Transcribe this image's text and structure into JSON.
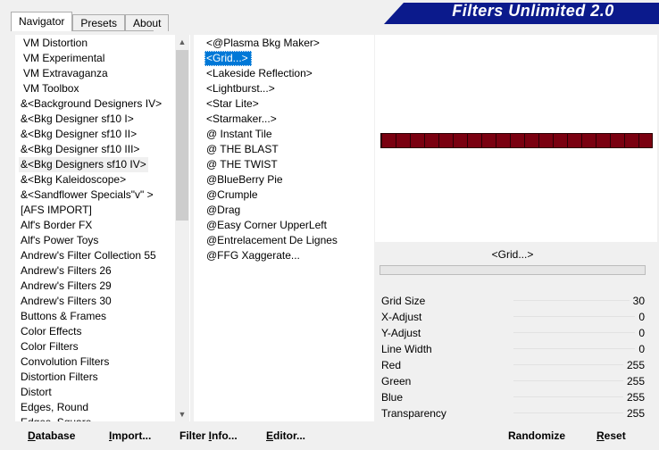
{
  "tabs": [
    {
      "label": "Navigator",
      "active": true
    },
    {
      "label": "Presets",
      "active": false
    },
    {
      "label": "About",
      "active": false
    }
  ],
  "banner": {
    "title": "Filters Unlimited 2.0",
    "color": "#0b1a8c"
  },
  "categories": [
    "VM Distortion",
    "VM Experimental",
    "VM Extravaganza",
    "VM Toolbox",
    "&<Background Designers IV>",
    "&<Bkg Designer sf10 I>",
    "&<Bkg Designer sf10 II>",
    "&<Bkg Designer sf10 III>",
    "&<Bkg Designers sf10 IV>",
    "&<Bkg Kaleidoscope>",
    "&<Sandflower Specials\"v\" >",
    "[AFS IMPORT]",
    "Alf's Border FX",
    "Alf's Power Toys",
    "Andrew's Filter Collection 55",
    "Andrew's Filters 26",
    "Andrew's Filters 29",
    "Andrew's Filters 30",
    "Buttons & Frames",
    "Color Effects",
    "Color Filters",
    "Convolution Filters",
    "Distortion Filters",
    "Distort",
    "Edges, Round",
    "Edges, Square"
  ],
  "category_highlighted_index": 8,
  "filters": [
    "<@Plasma Bkg Maker>",
    "<Grid...>",
    "<Lakeside Reflection>",
    "<Lightburst...>",
    "<Star Lite>",
    "<Starmaker...>",
    "@ Instant Tile",
    "@ THE BLAST",
    "@ THE TWIST",
    "@BlueBerry Pie",
    "@Crumple",
    "@Drag",
    "@Easy Corner UpperLeft",
    "@Entrelacement De Lignes",
    "@FFG Xaggerate..."
  ],
  "filter_selected_index": 1,
  "selected_filter_name": "<Grid...>",
  "progress": 0,
  "preview": {
    "grid_color": "#7a0010",
    "grid_line_color": "#2a0004"
  },
  "parameters": [
    {
      "name": "Grid Size",
      "value": "30"
    },
    {
      "name": "X-Adjust",
      "value": "0"
    },
    {
      "name": "Y-Adjust",
      "value": "0"
    },
    {
      "name": "Line Width",
      "value": "0"
    },
    {
      "name": "Red",
      "value": "255"
    },
    {
      "name": "Green",
      "value": "255"
    },
    {
      "name": "Blue",
      "value": "255"
    },
    {
      "name": "Transparency",
      "value": "255"
    }
  ],
  "buttons": {
    "database": {
      "label": "Database",
      "key": "D",
      "rest": "atabase"
    },
    "import": {
      "label": "Import...",
      "key": "I",
      "rest": "mport..."
    },
    "filter_info": {
      "label": "Filter Info...",
      "pre": "Filter ",
      "key": "I",
      "rest": "nfo..."
    },
    "editor": {
      "label": "Editor...",
      "key": "E",
      "rest": "ditor..."
    },
    "randomize": {
      "label": "Randomize"
    },
    "reset": {
      "label": "Reset",
      "key": "R",
      "rest": "eset"
    }
  },
  "icons": {
    "scroll_up": "chevron-up-icon",
    "scroll_down": "chevron-down-icon"
  }
}
